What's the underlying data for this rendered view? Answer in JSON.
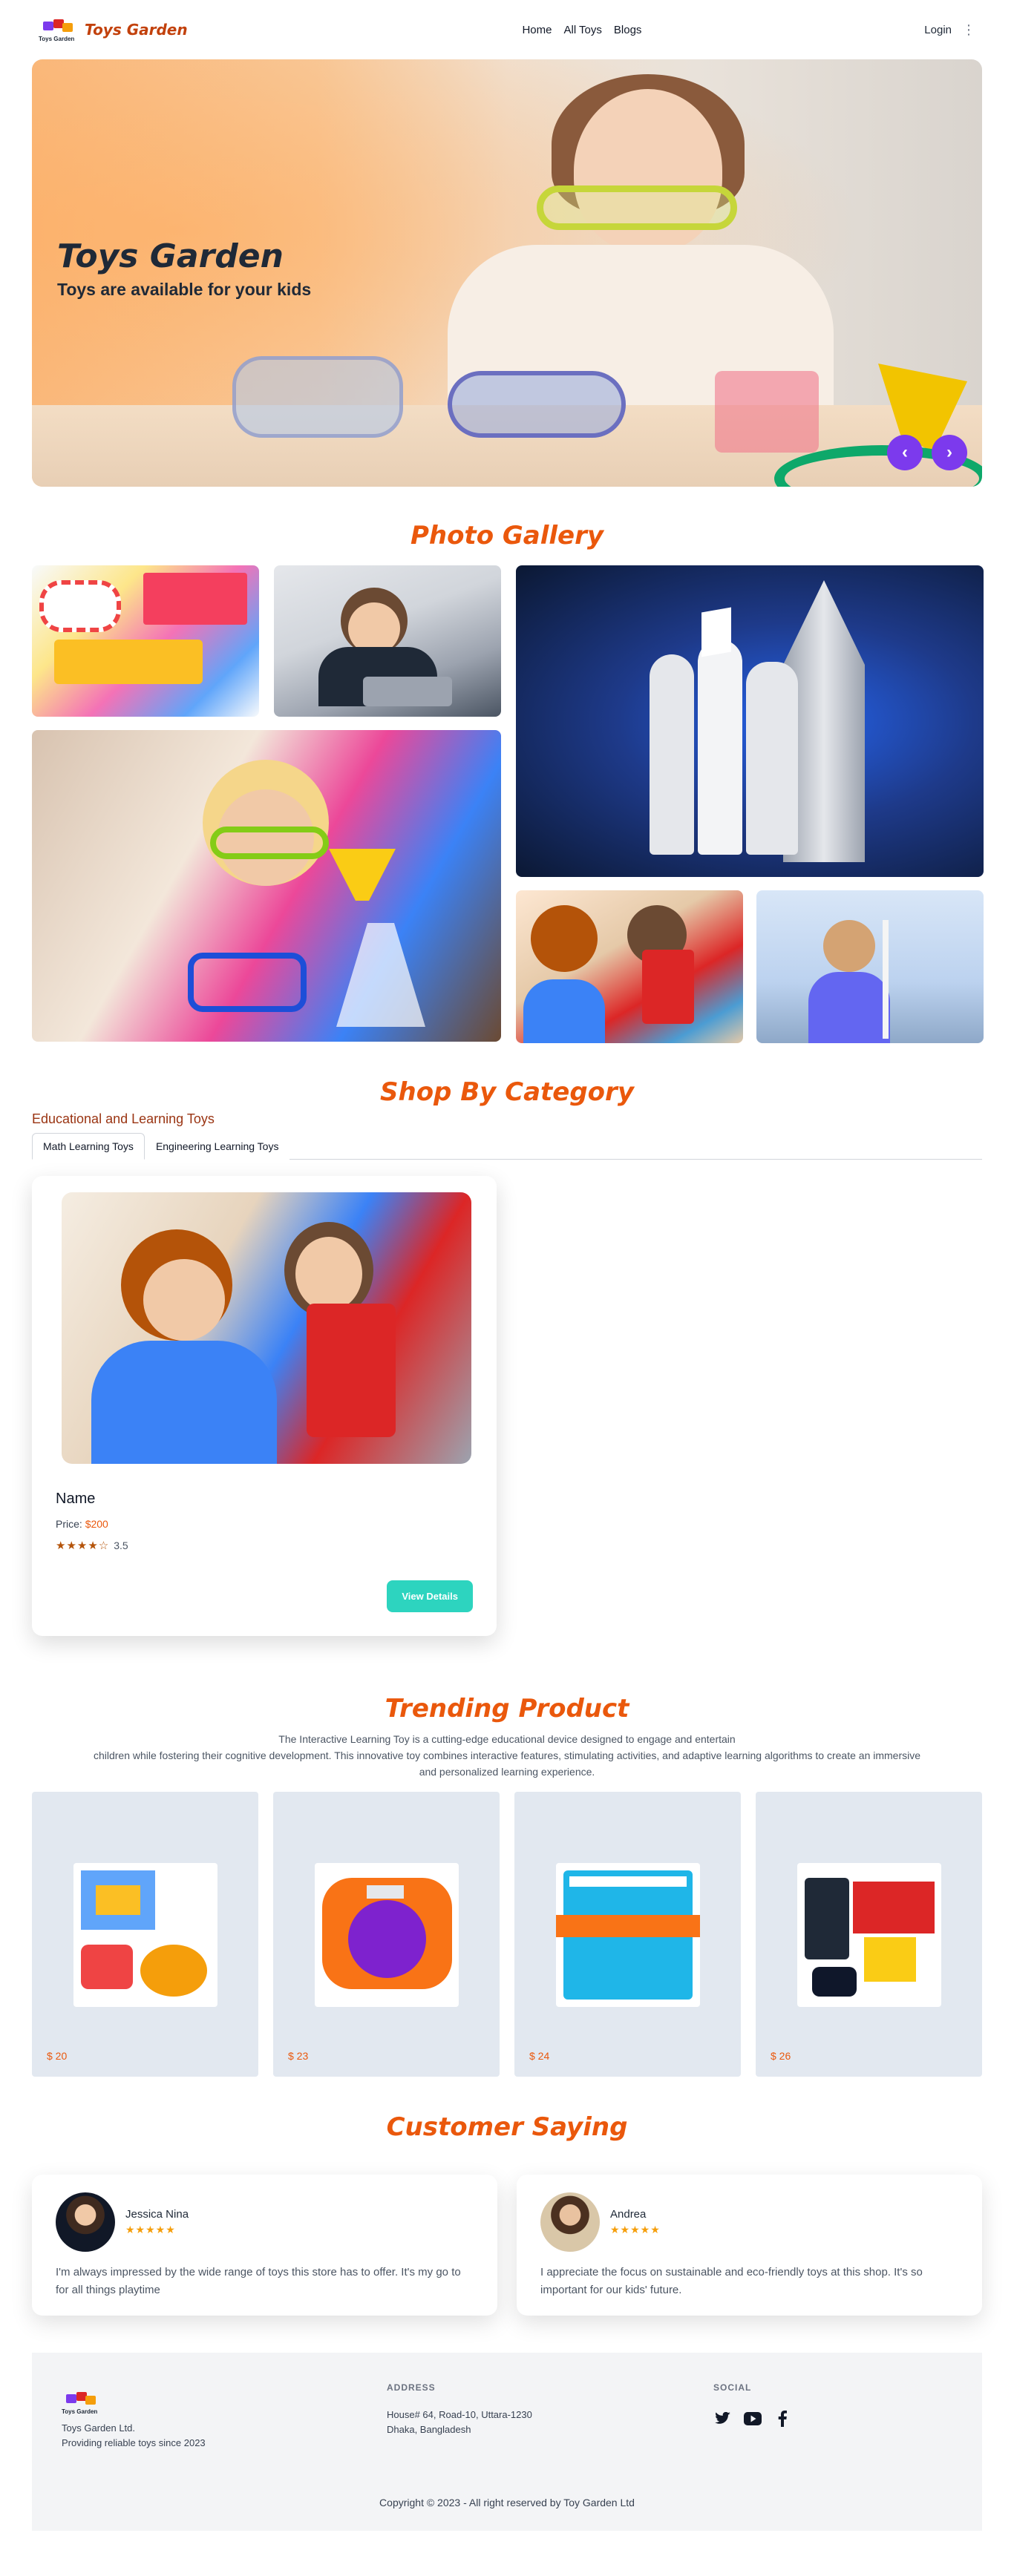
{
  "nav": {
    "brand": "Toys Garden",
    "logo_text": "Toys Garden",
    "links": [
      "Home",
      "All Toys",
      "Blogs"
    ],
    "login": "Login",
    "menu_icon": "kebab-icon"
  },
  "hero": {
    "title": "Toys Garden",
    "subtitle": "Toys are available for your kids",
    "prev_icon": "chevron-left-icon",
    "next_icon": "chevron-right-icon",
    "prev_glyph": "‹",
    "next_glyph": "›",
    "accent": "#7c3aed"
  },
  "gallery": {
    "title": "Photo Gallery"
  },
  "category": {
    "title": "Shop By Category",
    "heading": "Educational and Learning Toys",
    "tabs": [
      "Math Learning Toys",
      "Engineering Learning Toys"
    ],
    "product": {
      "name": "Name",
      "price_label": "Price:",
      "price": "$200",
      "stars": "★★★★☆",
      "rating": "3.5",
      "button": "View Details"
    }
  },
  "trending": {
    "title": "Trending Product",
    "description_line1": "The Interactive Learning Toy is a cutting-edge educational device designed to engage and entertain",
    "description_line2": "children while fostering their cognitive development. This innovative toy combines interactive features, stimulating activities, and adaptive learning algorithms to create an immersive",
    "description_line3": "and personalized learning experience.",
    "prices": [
      "$ 20",
      "$ 23",
      "$ 24",
      "$ 26"
    ]
  },
  "testimonials": {
    "title": "Customer Saying",
    "items": [
      {
        "name": "Jessica Nina",
        "stars": "★★★★★",
        "quote": "I'm always impressed by the wide range of toys this store has to offer. It's my go to for all things playtime"
      },
      {
        "name": "Andrea",
        "stars": "★★★★★",
        "quote": "I appreciate the focus on sustainable and eco-friendly toys at this shop. It's so important for our kids' future."
      }
    ]
  },
  "footer": {
    "logo_text": "Toys Garden",
    "company": "Toys Garden Ltd.",
    "tagline": "Providing reliable toys since 2023",
    "address_head": "ADDRESS",
    "address_line1": "House# 64, Road-10, Uttara-1230",
    "address_line2": "Dhaka, Bangladesh",
    "social_head": "SOCIAL",
    "social_icons": [
      "twitter-icon",
      "youtube-icon",
      "facebook-icon"
    ],
    "copyright": "Copyright © 2023 - All right reserved by Toy Garden Ltd"
  },
  "colors": {
    "brand_orange": "#ea580c",
    "purple": "#7c3aed",
    "teal": "#2dd4bf",
    "card_gray": "#e2e8f0"
  }
}
